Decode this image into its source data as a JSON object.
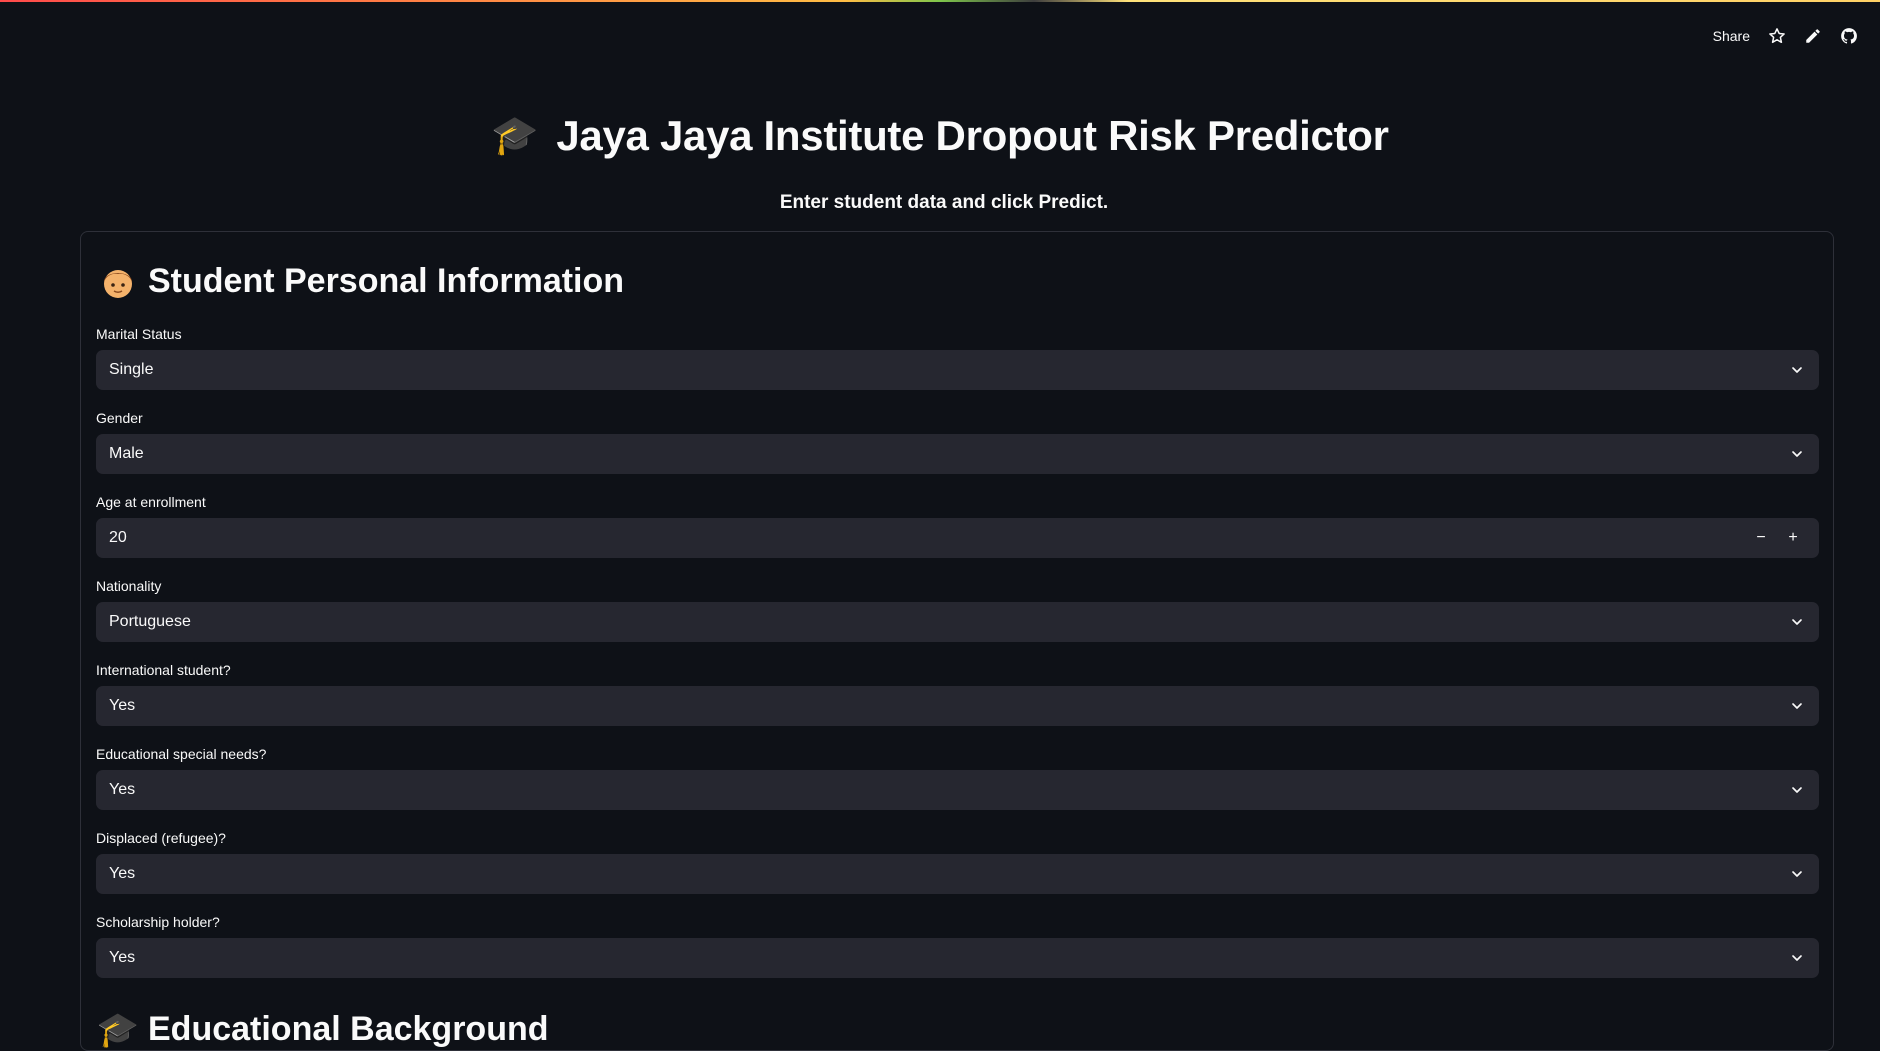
{
  "header": {
    "share_label": "Share",
    "icons": [
      "star-icon",
      "edit-icon",
      "github-icon"
    ]
  },
  "page": {
    "title": "Jaya Jaya Institute Dropout Risk Predictor",
    "title_emoji": "🎓",
    "subtitle": "Enter student data and click Predict."
  },
  "sections": {
    "personal": {
      "title": "Student Personal Information",
      "emoji": "🧒"
    },
    "educational": {
      "title": "Educational Background",
      "emoji": "🎓"
    }
  },
  "fields": {
    "marital_status": {
      "label": "Marital Status",
      "value": "Single"
    },
    "gender": {
      "label": "Gender",
      "value": "Male"
    },
    "age": {
      "label": "Age at enrollment",
      "value": "20",
      "minus": "−",
      "plus": "+"
    },
    "nationality": {
      "label": "Nationality",
      "value": "Portuguese"
    },
    "international": {
      "label": "International student?",
      "value": "Yes"
    },
    "special_needs": {
      "label": "Educational special needs?",
      "value": "Yes"
    },
    "displaced": {
      "label": "Displaced (refugee)?",
      "value": "Yes"
    },
    "scholarship": {
      "label": "Scholarship holder?",
      "value": "Yes"
    }
  },
  "colors": {
    "background": "#0e1117",
    "input_bg": "#262730",
    "text": "#fafafa",
    "border": "#2e3039"
  }
}
